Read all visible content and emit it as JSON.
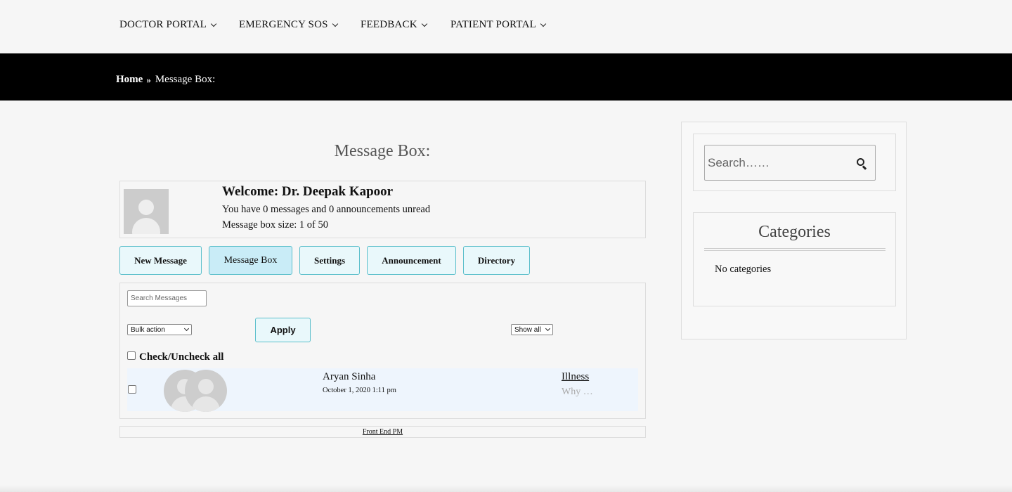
{
  "nav": {
    "items": [
      {
        "label": "DOCTOR PORTAL"
      },
      {
        "label": "EMERGENCY SOS"
      },
      {
        "label": "FEEDBACK"
      },
      {
        "label": "PATIENT PORTAL"
      }
    ]
  },
  "breadcrumb": {
    "home": "Home",
    "current": "Message Box:"
  },
  "main": {
    "title": "Message Box:",
    "welcome": {
      "greeting": "Welcome: Dr. Deepak Kapoor",
      "unread": "You have 0 messages and 0 announcements unread",
      "size": "Message box size: 1 of 50"
    },
    "buttons": {
      "new_message": "New Message",
      "message_box": "Message Box",
      "settings": "Settings",
      "announcement": "Announcement",
      "directory": "Directory"
    },
    "list": {
      "search_placeholder": "Search Messages",
      "bulk_action": "Bulk action",
      "apply": "Apply",
      "show_filter": "Show all",
      "check_all": "Check/Uncheck all",
      "messages": [
        {
          "from": "Aryan Sinha",
          "date": "October 1, 2020 1:11 pm",
          "subject": "Illness",
          "excerpt": "Why …"
        }
      ]
    },
    "footer_link": "Front End PM"
  },
  "sidebar": {
    "search_placeholder": "Search……",
    "categories_title": "Categories",
    "categories_empty": "No categories"
  },
  "colors": {
    "band": "#000000",
    "button_bg": "#e9f8fb",
    "button_border": "#5bbfcb",
    "button_active_bg": "#c9ecf7",
    "row_bg": "#eef5fd"
  }
}
